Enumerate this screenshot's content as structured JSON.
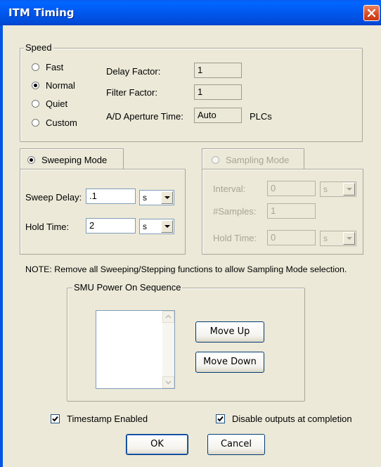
{
  "window": {
    "title": "ITM Timing"
  },
  "speed": {
    "legend": "Speed",
    "options": [
      "Fast",
      "Normal",
      "Quiet",
      "Custom"
    ],
    "selected": "Normal",
    "delay_factor_label": "Delay Factor:",
    "delay_factor_value": "1",
    "filter_factor_label": "Filter Factor:",
    "filter_factor_value": "1",
    "ad_aperture_label": "A/D Aperture Time:",
    "ad_aperture_value": "Auto",
    "ad_aperture_unit": "PLCs"
  },
  "sweeping_mode": {
    "label": "Sweeping Mode",
    "selected": true,
    "sweep_delay_label": "Sweep Delay:",
    "sweep_delay_value": ".1",
    "sweep_delay_unit": "s",
    "hold_time_label": "Hold Time:",
    "hold_time_value": "2",
    "hold_time_unit": "s"
  },
  "sampling_mode": {
    "label": "Sampling Mode",
    "enabled": false,
    "interval_label": "Interval:",
    "interval_value": "0",
    "interval_unit": "s",
    "samples_label": "#Samples:",
    "samples_value": "1",
    "hold_time_label": "Hold Time:",
    "hold_time_value": "0",
    "hold_time_unit": "s"
  },
  "note": "NOTE: Remove all Sweeping/Stepping functions to allow Sampling Mode selection.",
  "smu_sequence": {
    "legend": "SMU Power On Sequence",
    "items": [],
    "move_up_label": "Move Up",
    "move_down_label": "Move Down"
  },
  "options": {
    "timestamp_label": "Timestamp Enabled",
    "timestamp_checked": true,
    "disable_outputs_label": "Disable outputs at completion",
    "disable_outputs_checked": true
  },
  "buttons": {
    "ok": "OK",
    "cancel": "Cancel"
  }
}
